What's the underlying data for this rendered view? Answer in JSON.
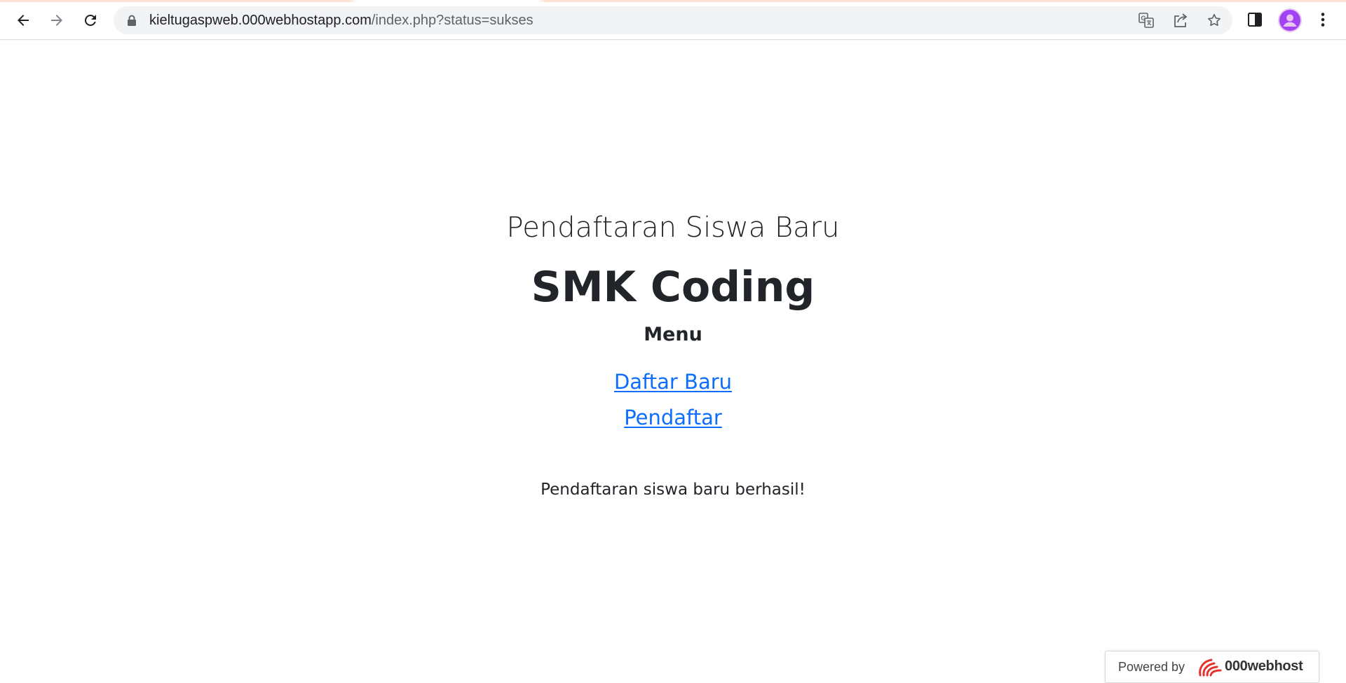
{
  "browser": {
    "url_host": "kieltugaspweb.000webhostapp.com",
    "url_path": "/index.php?status=sukses",
    "icons": [
      "back-icon",
      "forward-icon",
      "reload-icon",
      "lock-icon",
      "translate-icon",
      "share-icon",
      "bookmark-star-icon",
      "side-panel-icon",
      "profile-avatar",
      "more-menu-icon"
    ]
  },
  "page": {
    "subtitle": "Pendaftaran Siswa Baru",
    "title": "SMK Coding",
    "menu_heading": "Menu",
    "menu_links": [
      {
        "label": "Daftar Baru"
      },
      {
        "label": "Pendaftar"
      }
    ],
    "status_message": "Pendaftaran siswa baru berhasil!"
  },
  "badge": {
    "powered_label": "Powered by",
    "brand": "000webhost"
  },
  "colors": {
    "link": "#0d6efd",
    "text": "#212529",
    "avatar": "#a142f4",
    "brand_red": "#e3342f"
  }
}
